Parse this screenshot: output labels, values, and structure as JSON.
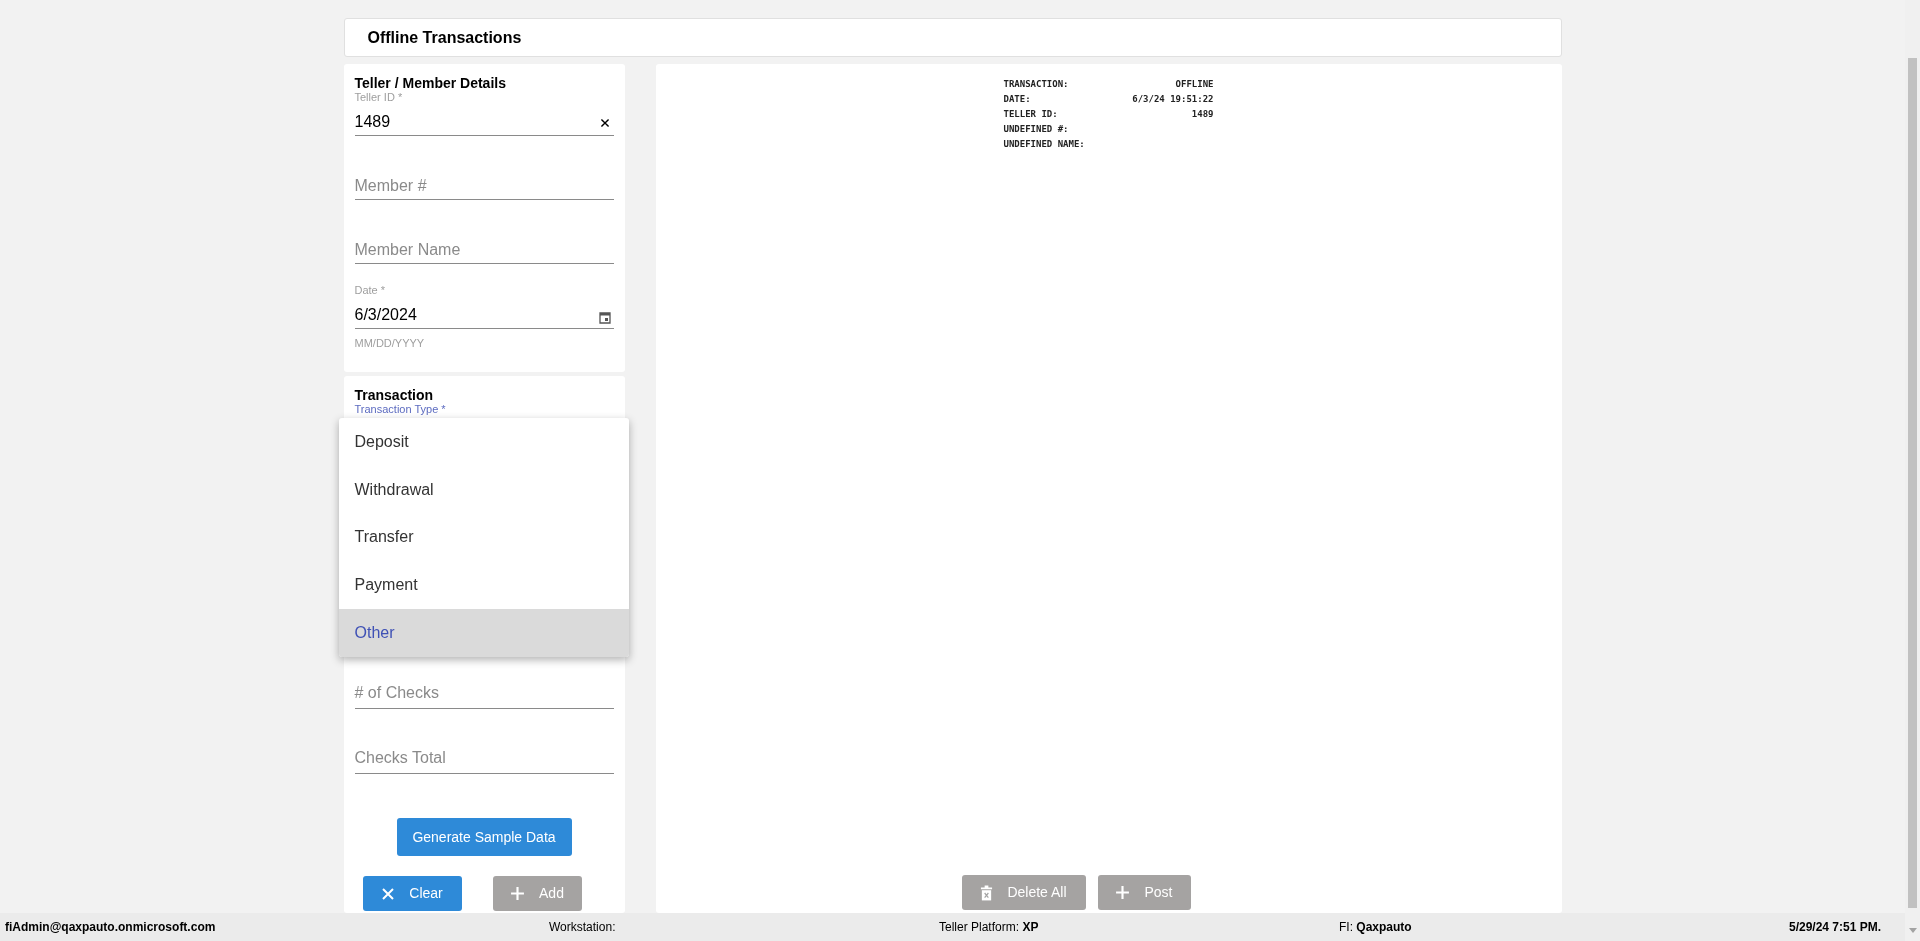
{
  "page_title": "Offline Transactions",
  "teller_member": {
    "title": "Teller / Member Details",
    "fields": [
      {
        "kind": "clearable",
        "label": "Teller ID *",
        "value": "1489"
      },
      {
        "kind": "text",
        "placeholder": "Member #"
      },
      {
        "kind": "text",
        "placeholder": "Member Name"
      },
      {
        "kind": "date",
        "label": "Date *",
        "value": "6/3/2024",
        "helper": "MM/DD/YYYY"
      }
    ]
  },
  "transaction": {
    "title": "Transaction",
    "type_label": "Transaction Type *",
    "fields": [
      {
        "placeholder": "# of Checks"
      },
      {
        "placeholder": "Checks Total"
      }
    ],
    "menu": [
      {
        "label": "Deposit",
        "selected": false
      },
      {
        "label": "Withdrawal",
        "selected": false
      },
      {
        "label": "Transfer",
        "selected": false
      },
      {
        "label": "Payment",
        "selected": false
      },
      {
        "label": "Other",
        "selected": true
      }
    ],
    "generate_button": "Generate Sample Data",
    "buttons": [
      {
        "kind": "clear",
        "label": "Clear",
        "disabled": false
      },
      {
        "kind": "add",
        "label": "Add",
        "disabled": true
      }
    ]
  },
  "receipt": [
    {
      "label": "TRANSACTION:",
      "value": "OFFLINE"
    },
    {
      "label": "DATE:",
      "value": "6/3/24 19:51:22"
    },
    {
      "label": "TELLER ID:",
      "value": "1489"
    },
    {
      "label": "UNDEFINED #:"
    },
    {
      "label": "UNDEFINED NAME:"
    }
  ],
  "receipt_buttons": [
    {
      "kind": "delete",
      "label": "Delete All",
      "disabled": true
    },
    {
      "kind": "add",
      "label": "Post",
      "disabled": true
    }
  ],
  "status_bar": {
    "user": "fiAdmin@qaxpauto.onmicrosoft.com",
    "workstation_label": "Workstation:",
    "platform_label": "Teller Platform:",
    "platform": "XP",
    "fi_label": "FI:",
    "fi": "Qaxpauto",
    "datetime": "5/29/24 7:51 PM."
  }
}
